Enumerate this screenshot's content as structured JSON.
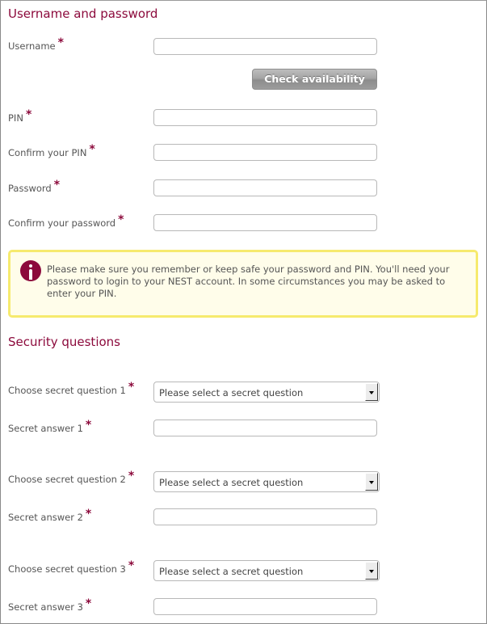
{
  "sections": {
    "credentials": {
      "title": "Username and password",
      "username": {
        "label": "Username",
        "required_mark": "*",
        "value": ""
      },
      "check_availability": "Check availability",
      "pin": {
        "label": "PIN",
        "required_mark": "*",
        "value": ""
      },
      "confirm_pin": {
        "label": "Confirm your PIN",
        "required_mark": "*",
        "value": ""
      },
      "password": {
        "label": "Password",
        "required_mark": "*",
        "value": ""
      },
      "confirm_password": {
        "label": "Confirm your password",
        "required_mark": "*",
        "value": ""
      }
    },
    "notice": {
      "icon": "info-icon",
      "text": "Please make sure you remember or keep safe your password and PIN. You'll need your password to login to your NEST account. In some circumstances you may be asked to enter your PIN."
    },
    "security": {
      "title": "Security questions",
      "questions": [
        {
          "question_label": "Choose secret question 1",
          "selected": "Please select a secret question",
          "answer_label": "Secret answer 1",
          "required_mark": "*",
          "answer_value": ""
        },
        {
          "question_label": "Choose secret question 2",
          "selected": "Please select a secret question",
          "answer_label": "Secret answer 2",
          "required_mark": "*",
          "answer_value": ""
        },
        {
          "question_label": "Choose secret question 3",
          "selected": "Please select a secret question",
          "answer_label": "Secret answer 3",
          "required_mark": "*",
          "answer_value": ""
        }
      ]
    }
  },
  "colors": {
    "accent": "#8c0a3c",
    "notice_border": "#f6ea6e",
    "notice_bg": "#fffdea"
  }
}
